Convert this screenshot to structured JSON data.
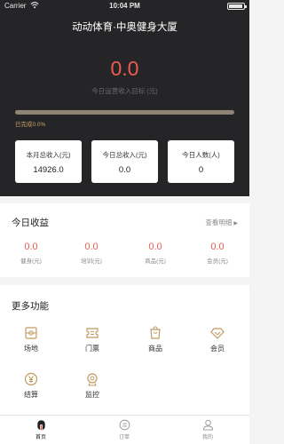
{
  "status_bar": {
    "carrier": "Carrier",
    "time": "10:04 PM"
  },
  "header": {
    "title": "动动体育·中奥健身大厦",
    "today_revenue": "0.0",
    "today_revenue_label": "今日运营收入目标 (元)",
    "progress_percent": 0.0,
    "progress_label": "已完成0.0%"
  },
  "stats": [
    {
      "label": "本月总收入(元)",
      "value": "14926.0"
    },
    {
      "label": "今日总收入(元)",
      "value": "0.0"
    },
    {
      "label": "今日人数(人)",
      "value": "0"
    }
  ],
  "income": {
    "title": "今日收益",
    "link": "查看明细",
    "items": [
      {
        "value": "0.0",
        "label": "健身(元)"
      },
      {
        "value": "0.0",
        "label": "培训(元)"
      },
      {
        "value": "0.0",
        "label": "商品(元)"
      },
      {
        "value": "0.0",
        "label": "会员(元)"
      }
    ]
  },
  "more": {
    "title": "更多功能",
    "items": [
      {
        "label": "场地",
        "icon": "venue-icon"
      },
      {
        "label": "门票",
        "icon": "ticket-icon"
      },
      {
        "label": "商品",
        "icon": "goods-icon"
      },
      {
        "label": "会员",
        "icon": "diamond-icon"
      },
      {
        "label": "结算",
        "icon": "yen-icon"
      },
      {
        "label": "监控",
        "icon": "camera-icon"
      }
    ]
  },
  "tabbar": {
    "items": [
      {
        "label": "首页",
        "icon": "home-icon",
        "active": true
      },
      {
        "label": "订单",
        "icon": "order-icon",
        "active": false
      },
      {
        "label": "我的",
        "icon": "profile-icon",
        "active": false
      }
    ]
  },
  "colors": {
    "accent_red": "#ee5a50",
    "gold": "#c9a472",
    "dark_bg": "#252527"
  }
}
